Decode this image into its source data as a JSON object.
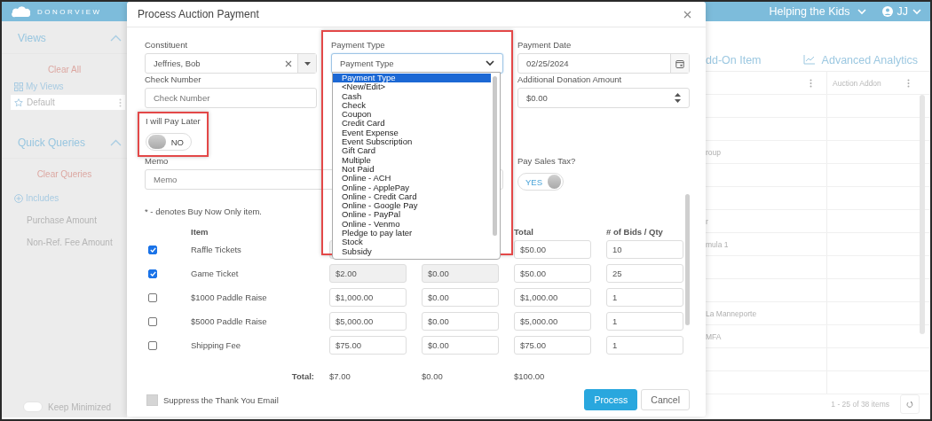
{
  "app": {
    "logo": "DONORVIEW",
    "organization": "Helping the Kids",
    "user": "JJ"
  },
  "sidebar": {
    "views_title": "Views",
    "clear_all": "Clear All",
    "my_views": "My Views",
    "views": [
      {
        "label": "Default",
        "selected": true
      }
    ],
    "queries_title": "Quick Queries",
    "clear_queries": "Clear Queries",
    "includes": "Includes",
    "query_fields": [
      "Purchase Amount",
      "Non-Ref. Fee Amount"
    ],
    "keep_minimized": {
      "label": "Keep Minimized",
      "on": false
    }
  },
  "main": {
    "add_on_link": "dd-On Item",
    "analytics_link": "Advanced Analytics",
    "column_2": "Auction Addon",
    "rows": [
      {},
      {},
      {
        "column_1": "roup"
      },
      {},
      {},
      {
        "column_1": "r"
      },
      {
        "column_1": "mula 1"
      },
      {},
      {},
      {
        "column_1": "La Manneporte"
      },
      {
        "column_1": "MFA"
      },
      {},
      {}
    ],
    "pager": "1 - 25 of 38 items"
  },
  "dialog": {
    "title": "Process Auction Payment",
    "constituent": {
      "label": "Constituent",
      "value": "Jeffries, Bob"
    },
    "payment_type": {
      "label": "Payment Type",
      "value": "Payment Type",
      "highlighted": true,
      "expanded": true,
      "options": [
        {
          "label": "Payment Type",
          "selected": true
        },
        {
          "label": "<New/Edit>",
          "selected": false
        },
        {
          "label": "Cash",
          "selected": false
        },
        {
          "label": "Check",
          "selected": false
        },
        {
          "label": "Coupon",
          "selected": false
        },
        {
          "label": "Credit Card",
          "selected": false
        },
        {
          "label": "Event Expense",
          "selected": false
        },
        {
          "label": "Event Subscription",
          "selected": false
        },
        {
          "label": "Gift Card",
          "selected": false
        },
        {
          "label": "Multiple",
          "selected": false
        },
        {
          "label": "Not Paid",
          "selected": false
        },
        {
          "label": "Online - ACH",
          "selected": false
        },
        {
          "label": "Online - ApplePay",
          "selected": false
        },
        {
          "label": "Online - Credit Card",
          "selected": false
        },
        {
          "label": "Online - Google Pay",
          "selected": false
        },
        {
          "label": "Online - PayPal",
          "selected": false
        },
        {
          "label": "Online - Venmo",
          "selected": false
        },
        {
          "label": "Pledge to pay later",
          "selected": false
        },
        {
          "label": "Stock",
          "selected": false
        },
        {
          "label": "Subsidy",
          "selected": false
        }
      ]
    },
    "payment_date": {
      "label": "Payment Date",
      "value": "02/25/2024"
    },
    "check_number": {
      "label": "Check Number",
      "placeholder": "Check Number"
    },
    "additional_donation": {
      "label": "Additional Donation Amount",
      "value": "$0.00"
    },
    "pay_later": {
      "label": "I will Pay Later",
      "state_text": "NO",
      "on": false,
      "highlighted": true
    },
    "memo": {
      "label": "Memo",
      "placeholder": "Memo"
    },
    "sales_tax": {
      "label": "Pay Sales Tax?",
      "state_text": "YES",
      "on": true
    },
    "note": "* - denotes Buy Now Only item.",
    "item_header": "Item",
    "total_header": "Total",
    "qty_header": "# of Bids / Qty",
    "items": [
      {
        "checked": true,
        "item": "Raffle Tickets",
        "locked": true,
        "total": "$50.00",
        "qty": "10"
      },
      {
        "checked": true,
        "item": "Game Ticket",
        "locked": true,
        "amount": "$2.00",
        "fee": "$0.00",
        "total": "$50.00",
        "qty": "25"
      },
      {
        "checked": false,
        "item": "$1000 Paddle Raise",
        "locked": false,
        "amount": "$1,000.00",
        "fee": "$0.00",
        "total": "$1,000.00",
        "qty": "1"
      },
      {
        "checked": false,
        "item": "$5000 Paddle Raise",
        "locked": false,
        "amount": "$5,000.00",
        "fee": "$0.00",
        "total": "$5,000.00",
        "qty": "1"
      },
      {
        "checked": false,
        "item": "Shipping Fee",
        "locked": false,
        "amount": "$75.00",
        "fee": "$0.00",
        "total": "$75.00",
        "qty": "1"
      }
    ],
    "totals": {
      "label": "Total:",
      "amount": "$7.00",
      "fee": "$0.00",
      "total": "$100.00"
    },
    "suppress_email": {
      "label": "Suppress the Thank You Email",
      "checked": false
    },
    "buttons": [
      {
        "label": "Process",
        "kind": "primary"
      },
      {
        "label": "Cancel",
        "kind": "secondary"
      }
    ]
  }
}
